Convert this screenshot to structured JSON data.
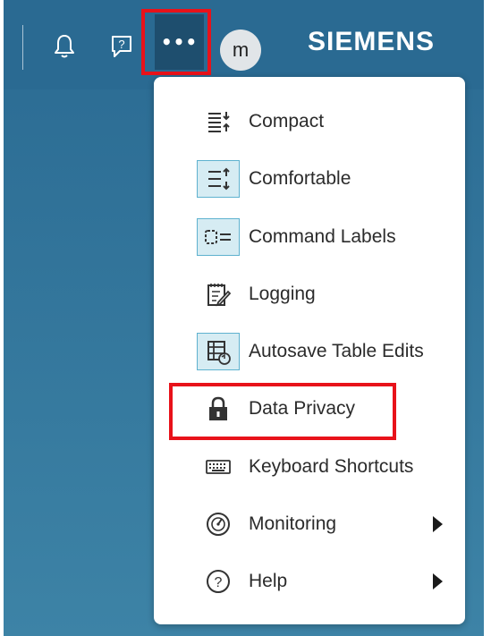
{
  "header": {
    "brand": "SIEMENS",
    "avatar_initial": "m",
    "more_label": "•••",
    "icons": [
      "bell-icon",
      "help-chat-icon",
      "more-icon"
    ]
  },
  "menu": {
    "items": [
      {
        "label": "Compact",
        "icon": "compact-density-icon",
        "selected": false,
        "submenu": false
      },
      {
        "label": "Comfortable",
        "icon": "comfortable-density-icon",
        "selected": true,
        "submenu": false
      },
      {
        "label": "Command Labels",
        "icon": "command-labels-icon",
        "selected": true,
        "submenu": false
      },
      {
        "label": "Logging",
        "icon": "logging-icon",
        "selected": false,
        "submenu": false
      },
      {
        "label": "Autosave Table Edits",
        "icon": "autosave-table-icon",
        "selected": true,
        "submenu": false
      },
      {
        "label": "Data Privacy",
        "icon": "lock-icon",
        "selected": false,
        "submenu": false
      },
      {
        "label": "Keyboard Shortcuts",
        "icon": "keyboard-icon",
        "selected": false,
        "submenu": false
      },
      {
        "label": "Monitoring",
        "icon": "gauge-icon",
        "selected": false,
        "submenu": true
      },
      {
        "label": "Help",
        "icon": "help-circle-icon",
        "selected": false,
        "submenu": true
      }
    ]
  },
  "colors": {
    "header_bg": "#2a6a92",
    "more_button_bg": "#1e4e6e",
    "highlight": "#e8121a",
    "selected_icon_bg": "#d6ecf3",
    "selected_icon_border": "#5fb2cf"
  }
}
